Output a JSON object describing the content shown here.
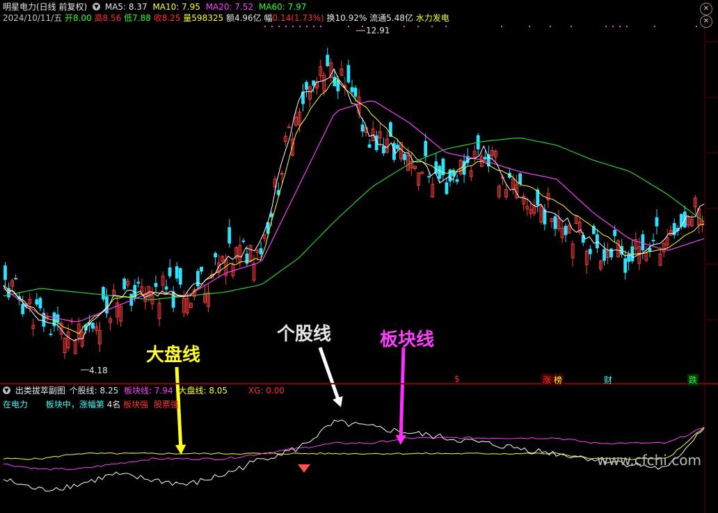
{
  "header": {
    "stock_title": "明星电力(日线 前复权)",
    "ma5_label": "MA5: 8.37",
    "ma10_label": "MA10: 7.95",
    "ma20_label": "MA20: 7.52",
    "ma60_label": "MA60: 7.97",
    "date": "2024/10/11/五",
    "open": "开8.00",
    "high": "高8.56",
    "low": "低7.88",
    "close": "收8.25",
    "volume": "量598325",
    "amount": "额4.96亿",
    "change_label": "幅",
    "change_value": "0.14(1.73%)",
    "turnover": "换10.92%",
    "float_cap": "流通5.48亿",
    "sector": "水力发电"
  },
  "price_annotations": {
    "high_mark": "12.91",
    "low_mark": "4.18"
  },
  "event_markers": [
    "$",
    "涨",
    "榜",
    "财",
    "跌"
  ],
  "sub_panel": {
    "name": "出类拔萃副图",
    "stock_line_label": "个股线: 8.25",
    "sector_line_label": "板块线: 7.94",
    "market_line_label": "大盘线: 8.05",
    "xg_label": "XG: 0.00",
    "row2_a": "在电力",
    "row2_b": "板块中，涨幅第",
    "row2_rank": "4名",
    "row2_c": "板块强",
    "row2_d": "股票强"
  },
  "annotations": {
    "market_line": "大盘线",
    "stock_line": "个股线",
    "sector_line": "板块线"
  },
  "watermark": "www.cfchi.com",
  "colors": {
    "background": "#000000",
    "up_candle": "#ff3c3c",
    "down_candle": "#30e0ff",
    "ma5": "#ffffff",
    "ma10": "#ffff40",
    "ma20": "#ff40ff",
    "ma60": "#30d030",
    "sector_line": "#ff40ff",
    "market_line": "#ffff40",
    "stock_line": "#ffffff"
  },
  "chart_data": {
    "type": "line",
    "ma60_series": [
      6.0,
      6.2,
      6.1,
      6.0,
      5.9,
      6.0,
      6.1,
      6.3,
      7.0,
      8.0,
      8.9,
      9.5,
      9.9,
      10.1,
      10.2,
      10.0,
      9.6,
      9.3,
      8.7,
      7.97
    ],
    "ma20_series": [
      6.2,
      5.5,
      5.3,
      5.7,
      6.1,
      6.0,
      6.6,
      6.9,
      8.9,
      10.9,
      11.2,
      10.6,
      9.8,
      9.6,
      9.3,
      9.1,
      8.2,
      7.5,
      7.2,
      7.52
    ],
    "ma10_series": [
      6.3,
      5.5,
      5.0,
      5.9,
      6.1,
      6.0,
      6.8,
      7.0,
      10.5,
      11.8,
      10.8,
      9.8,
      9.2,
      9.6,
      9.0,
      8.5,
      7.8,
      7.1,
      7.3,
      7.95
    ],
    "ma5_series": [
      6.3,
      5.4,
      4.8,
      6.0,
      6.1,
      6.1,
      6.9,
      7.4,
      11.2,
      12.0,
      10.2,
      9.7,
      9.0,
      9.9,
      8.6,
      8.2,
      7.4,
      7.0,
      7.6,
      8.37
    ],
    "sub_stock_series": [
      -2,
      -4,
      -3,
      -1,
      -2,
      -3,
      -1,
      2,
      4,
      9,
      8,
      7,
      6,
      5,
      4,
      3,
      2,
      1,
      0,
      8.25
    ],
    "sub_sector_series": [
      1,
      0,
      0,
      1,
      2,
      2,
      2,
      3,
      4,
      5,
      5,
      6,
      6,
      6,
      6,
      6,
      5,
      5,
      5,
      7.94
    ],
    "sub_market_series": [
      2,
      2,
      3,
      3,
      3,
      3,
      3,
      3,
      3,
      3,
      3,
      3,
      3,
      3,
      3,
      3,
      2,
      2,
      2,
      8.05
    ]
  }
}
